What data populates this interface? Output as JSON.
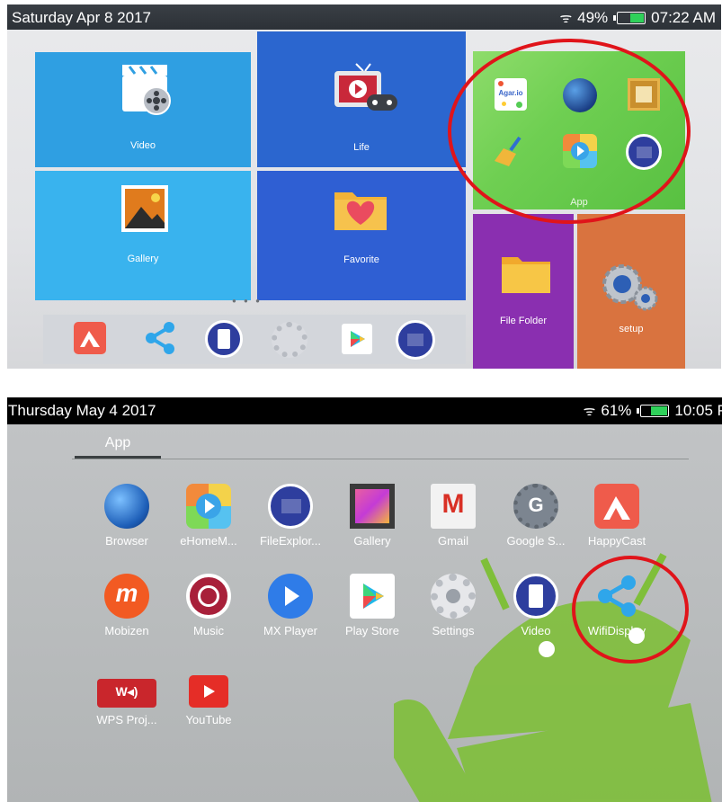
{
  "screen1": {
    "status": {
      "date": "Saturday Apr 8 2017",
      "battery_level": 0.49,
      "battery_pct": "49%",
      "time": "07:22 AM"
    },
    "tiles": {
      "video": "Video",
      "life": "Life",
      "gallery": "Gallery",
      "favorite": "Favorite",
      "app": "App",
      "file_folder": "File Folder",
      "setup": "setup"
    },
    "app_tile_icons": [
      "agar-io-icon",
      "globe-icon",
      "photo-frame-icon",
      "broom-icon",
      "ehome-media-icon",
      "folder-icon"
    ],
    "app_icon_text": "Agar.io",
    "dock_icons": [
      "happycast-icon",
      "share-icon",
      "video-icon",
      "settings-icon",
      "play-store-icon",
      "folder-icon"
    ],
    "page_dots": "● ● ●"
  },
  "screen2": {
    "status": {
      "date": "Thursday May 4 2017",
      "battery_level": 0.61,
      "battery_pct": "61%",
      "time": "10:05 P"
    },
    "tab": "App",
    "apps_row1": [
      "Browser",
      "eHomeM...",
      "FileExplor...",
      "Gallery",
      "Gmail",
      "Google S...",
      "HappyCast"
    ],
    "apps_row2": [
      "Mobizen",
      "Music",
      "MX Player",
      "Play Store",
      "Settings",
      "Video",
      "WifiDisplay"
    ],
    "apps_row3": [
      "WPS Proj...",
      "YouTube"
    ],
    "icon_text": {
      "gmail": "M",
      "google_settings": "G",
      "mobizen": "m",
      "wps": "W◂)"
    }
  },
  "colors": {
    "highlight_ring": "#e0141a",
    "battery_fill": "#2fd15a"
  }
}
